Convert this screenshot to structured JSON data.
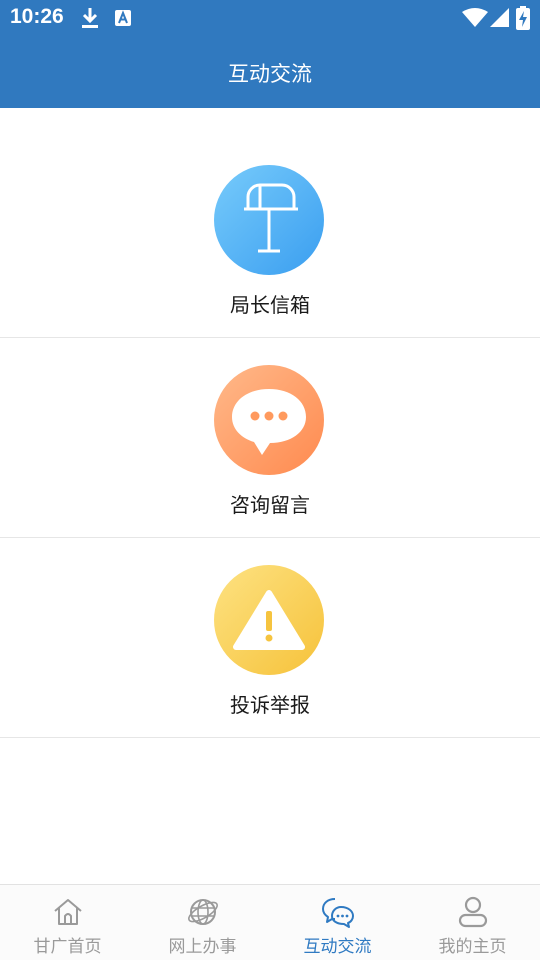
{
  "status_bar": {
    "time": "10:26",
    "icons": [
      "download-icon",
      "keyboard-a-icon",
      "wifi-icon",
      "signal-icon",
      "battery-charging-icon"
    ]
  },
  "header": {
    "title": "互动交流"
  },
  "entries": [
    {
      "label": "局长信箱",
      "icon": "mailbox-icon",
      "color": "#4fb6f5"
    },
    {
      "label": "咨询留言",
      "icon": "chat-bubble-icon",
      "color": "#ff9a5e"
    },
    {
      "label": "投诉举报",
      "icon": "warning-icon",
      "color": "#f7cb4d"
    }
  ],
  "tabbar": {
    "active_index": 2,
    "active_color": "#2f7ac2",
    "inactive_color": "#9a9a9a",
    "tabs": [
      {
        "label": "甘广首页",
        "icon": "home-icon"
      },
      {
        "label": "网上办事",
        "icon": "globe-icon"
      },
      {
        "label": "互动交流",
        "icon": "chat-icon"
      },
      {
        "label": "我的主页",
        "icon": "user-icon"
      }
    ]
  },
  "colors": {
    "header_bg": "#3079bf",
    "divider": "#e6e6e6"
  }
}
